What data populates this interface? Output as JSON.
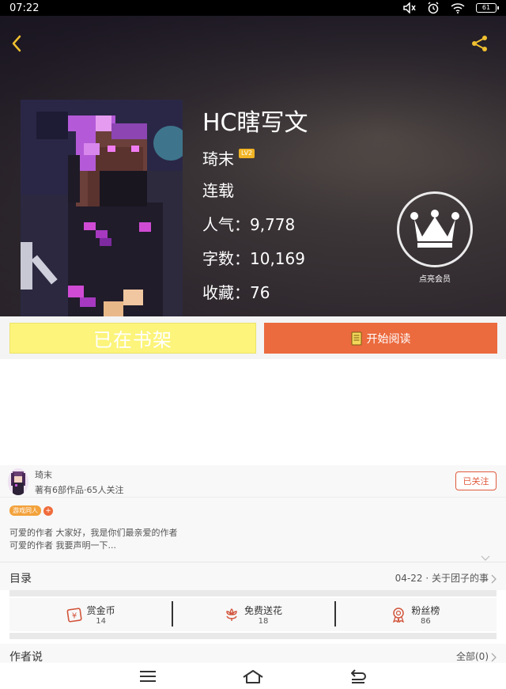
{
  "status_bar": {
    "time": "07:22",
    "battery": "61",
    "icons": [
      "mute-icon",
      "alarm-icon",
      "wifi-icon",
      "battery-icon"
    ]
  },
  "header": {
    "back_icon": "chevron-left-icon",
    "share_icon": "share-icon",
    "icon_color": "#f0c030"
  },
  "book": {
    "title": "HC瞎写文",
    "author": "琦末",
    "author_level": "LV2",
    "status": "连载",
    "popularity": "人气：9,778",
    "word_count": "字数：10,169",
    "favorites": "收藏：76"
  },
  "vip": {
    "icon": "crown-icon",
    "label": "点亮会员"
  },
  "actions": {
    "shelf_label": "已在书架",
    "read_label": "开始阅读",
    "read_icon": "book-icon",
    "shelf_color": "#fcf47b",
    "read_color": "#eb6a3e"
  },
  "author_card": {
    "name": "琦末",
    "meta": "著有6部作品·65人关注",
    "follow_label": "已关注"
  },
  "tags": {
    "items": [
      "游戏同人"
    ],
    "add": "+"
  },
  "description": {
    "line1": "可爱的作者 大家好，我是你们最亲爱的作者",
    "line2": "可爱的作者 我要声明一下..."
  },
  "toc": {
    "label": "目录",
    "latest": "04-22 · 关于团子的事"
  },
  "stats": [
    {
      "label": "赏金币",
      "value": "14",
      "icon": "reward-coin-icon"
    },
    {
      "label": "免费送花",
      "value": "18",
      "icon": "flower-icon"
    },
    {
      "label": "粉丝榜",
      "value": "86",
      "icon": "medal-icon"
    }
  ],
  "author_says": {
    "label": "作者说",
    "all": "全部(0)"
  },
  "nav_bar": {
    "icons": [
      "menu-icon",
      "home-icon",
      "back-icon"
    ]
  }
}
